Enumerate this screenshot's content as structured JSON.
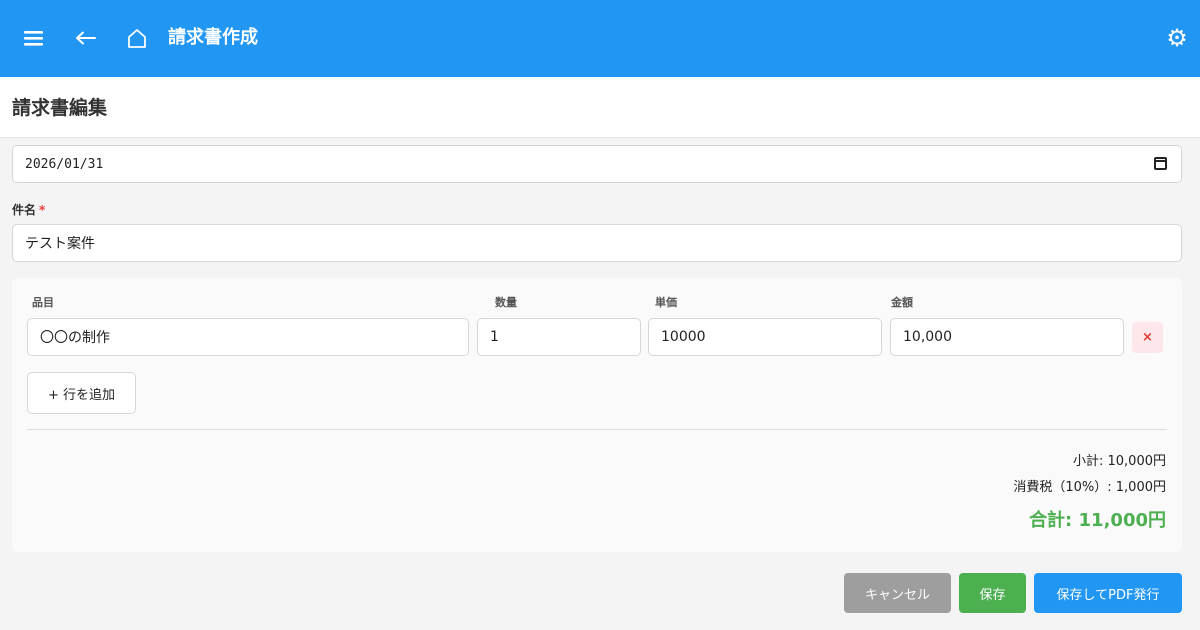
{
  "appbar": {
    "title": "請求書作成",
    "menu_icon": "hamburger-menu-icon",
    "back_icon": "arrow-left-icon",
    "home_icon": "home-icon",
    "settings_icon": "gear-icon",
    "color": "#2196f3"
  },
  "page": {
    "heading": "請求書編集"
  },
  "form": {
    "date_value": "2026/01/31",
    "name_label": "件名",
    "required_mark": "*",
    "name_value": "テスト案件"
  },
  "items": {
    "headers": {
      "item": "品目",
      "qty": "数量",
      "unit_price": "単価",
      "amount": "金額"
    },
    "rows": [
      {
        "item": "〇〇の制作",
        "qty": "1",
        "unit_price": "10000",
        "amount": "10,000",
        "delete_label": "×"
      }
    ],
    "add_row_label": "+ 行を追加"
  },
  "totals": {
    "subtotal": "小計: 10,000円",
    "tax": "消費税（10%）: 1,000円",
    "total": "合計: 11,000円",
    "total_color": "#4caf50"
  },
  "actions": {
    "cancel": "キャンセル",
    "save": "保存",
    "save_pdf": "保存してPDF発行"
  }
}
